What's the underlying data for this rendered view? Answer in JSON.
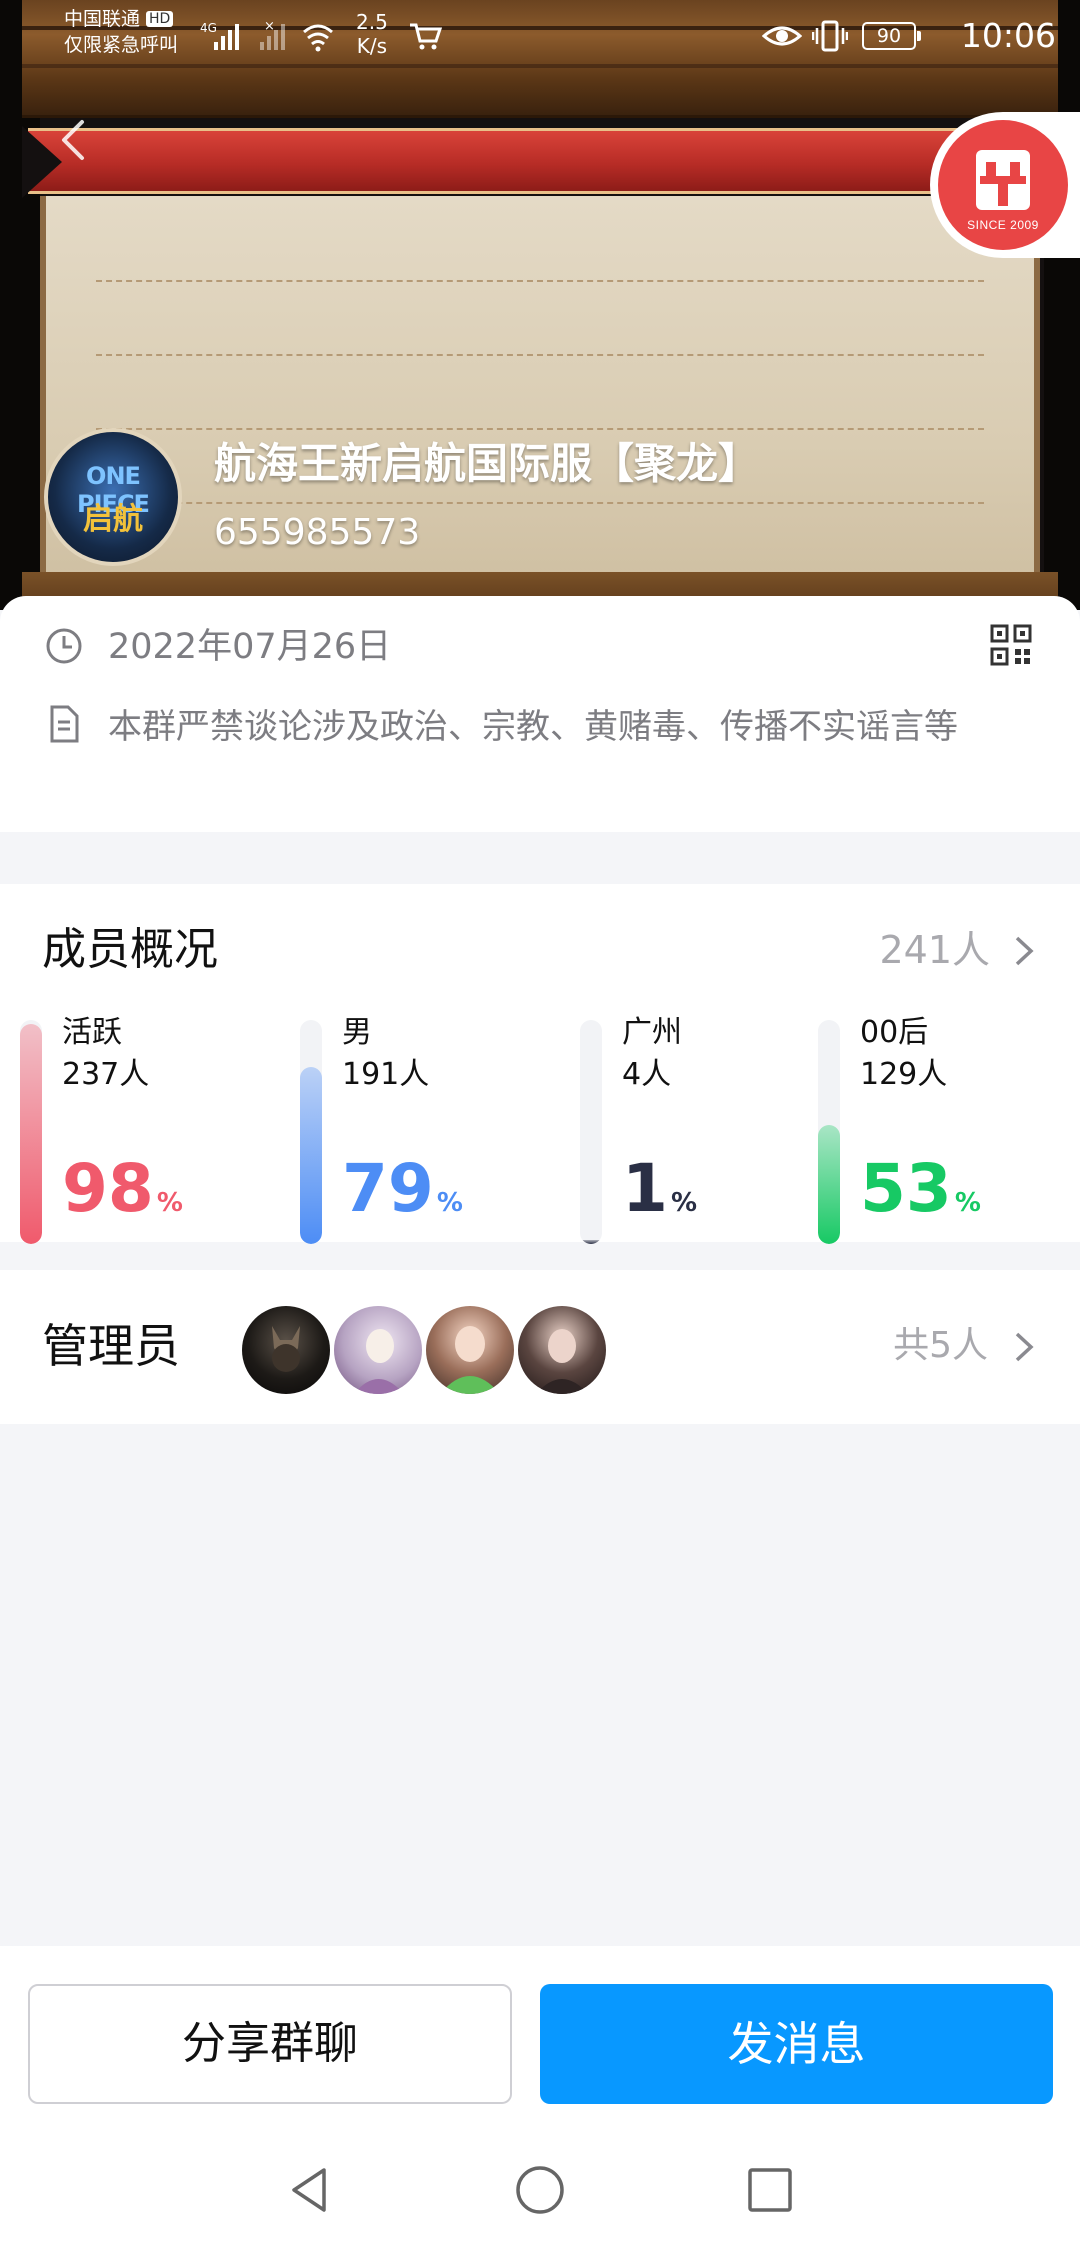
{
  "status_bar": {
    "carrier": "中国联通",
    "carrier_badge": "HD",
    "emergency": "仅限紧急呼叫",
    "network": "4G",
    "speed_value": "2.5",
    "speed_unit": "K/s",
    "battery": "90",
    "time": "10:06"
  },
  "group": {
    "name": "航海王新启航国际服【聚龙】",
    "id": "655985573",
    "avatar_text_top": "ONE PIECE",
    "avatar_text_bottom": "启航",
    "created_date": "2022年07月26日",
    "notice": "本群严禁谈论涉及政治、宗教、黄赌毒、传播不实谣言等"
  },
  "badge_logo": {
    "since": "SINCE 2009"
  },
  "members": {
    "title": "成员概况",
    "count": "241人",
    "stats": [
      {
        "label": "活跃",
        "count": "237人",
        "percent": 98,
        "unit": "%",
        "color": "#f05a6c"
      },
      {
        "label": "男",
        "count": "191人",
        "percent": 79,
        "unit": "%",
        "color": "#4d8df5"
      },
      {
        "label": "广州",
        "count": "4人",
        "percent": 1,
        "unit": "%",
        "color": "#2a2f45"
      },
      {
        "label": "00后",
        "count": "129人",
        "percent": 53,
        "unit": "%",
        "color": "#17c964"
      }
    ]
  },
  "admins": {
    "title": "管理员",
    "count": "共5人"
  },
  "actions": {
    "share": "分享群聊",
    "send": "发消息"
  },
  "colors": {
    "accent": "#0898ff",
    "text_muted": "#7d7d82",
    "ribbon": "#c2302a"
  }
}
